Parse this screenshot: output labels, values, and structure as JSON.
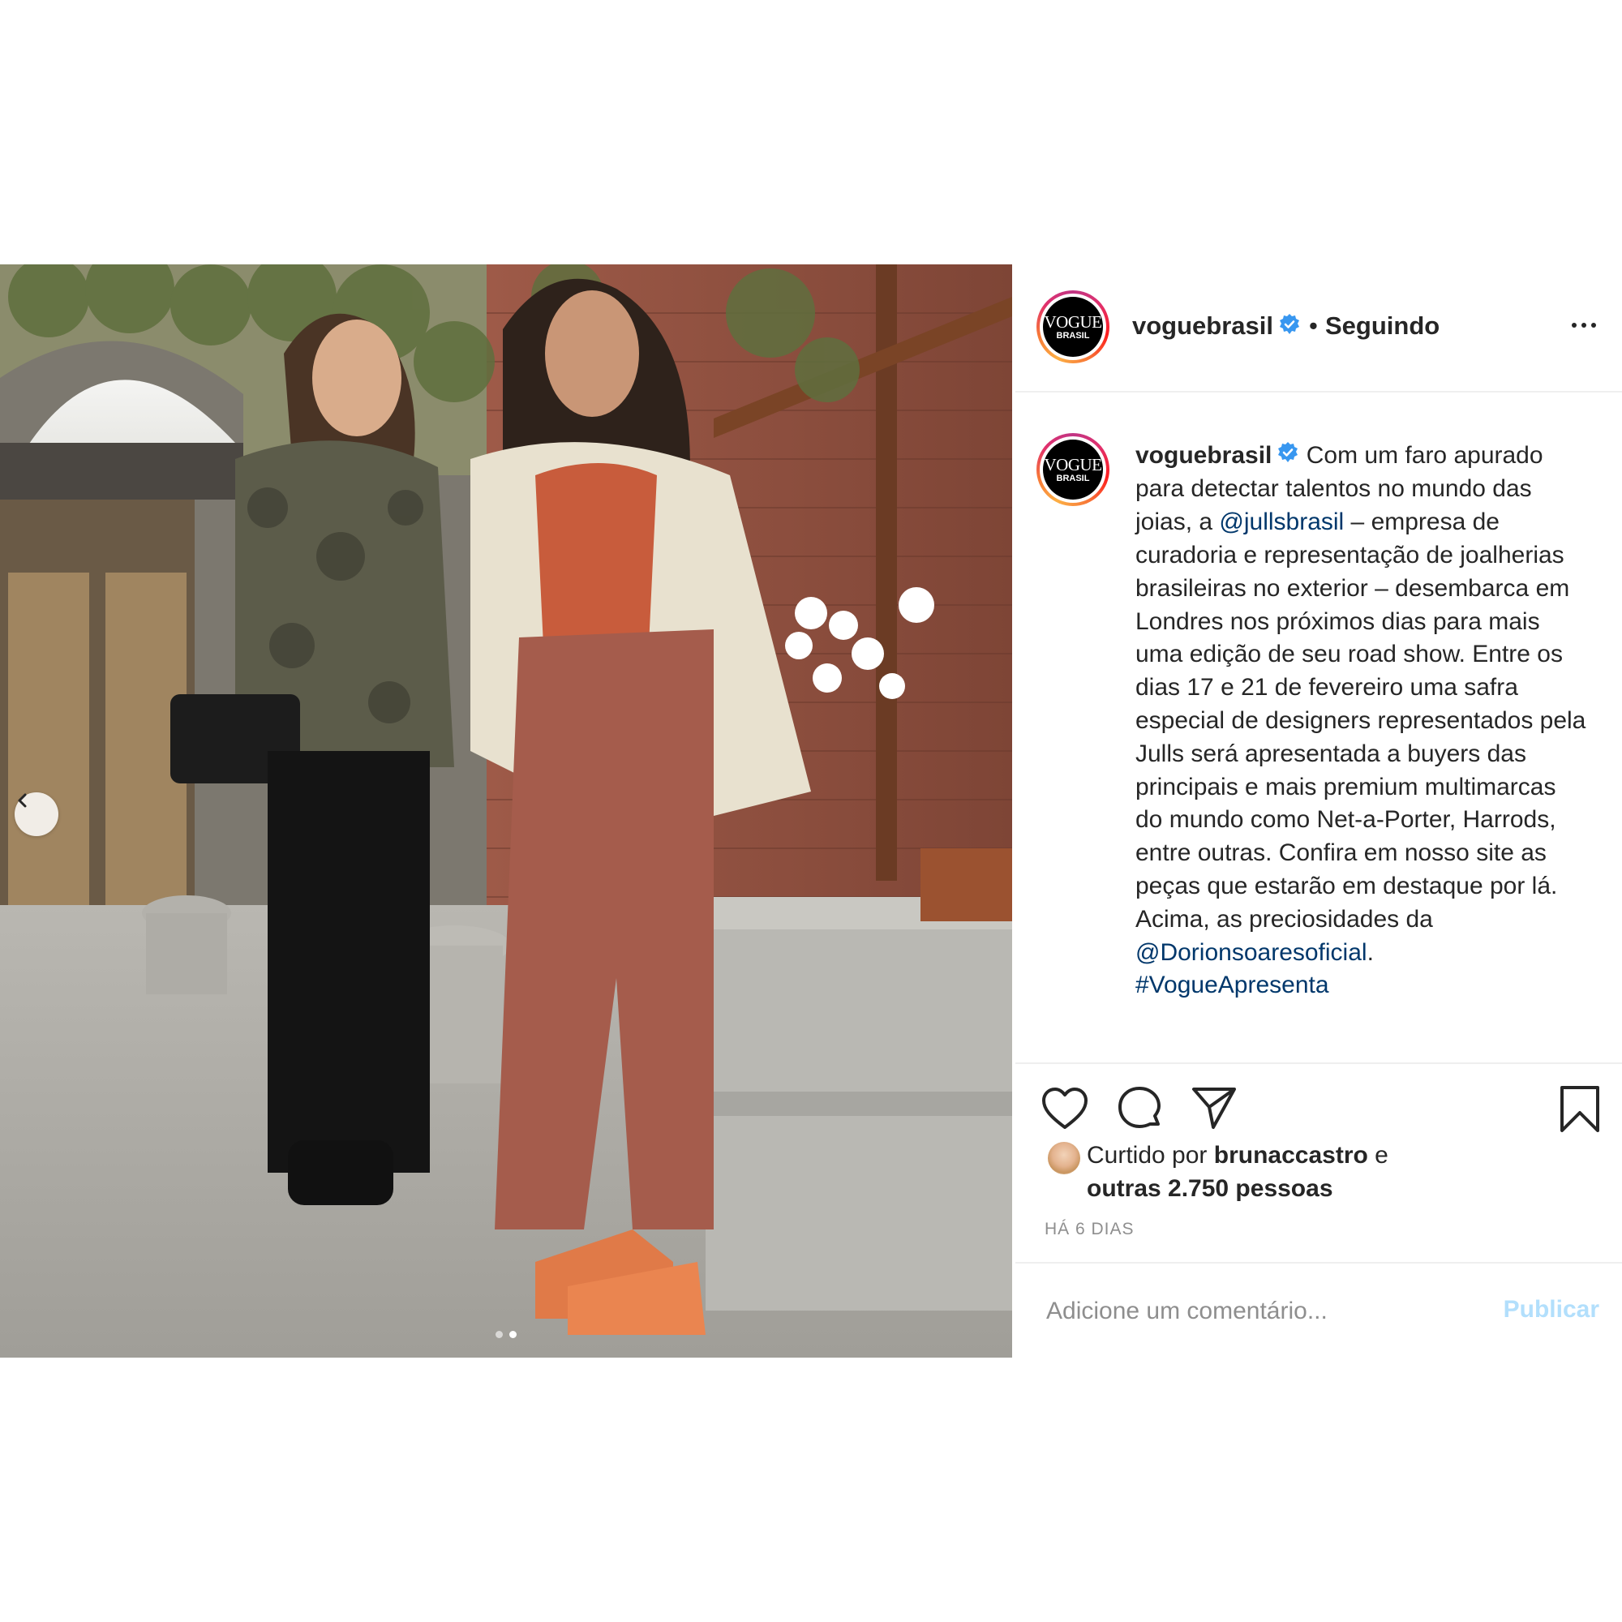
{
  "post": {
    "photo": {
      "alt_icon": "chevron-left-icon",
      "carousel_dots": 2,
      "active_dot": 1
    },
    "header": {
      "avatar_line1": "VOGUE",
      "avatar_line2": "BRASIL",
      "username": "voguebrasil",
      "separator": "•",
      "follow_status": "Seguindo",
      "more_icon": "more-options-icon"
    },
    "caption": {
      "username": "voguebrasil",
      "text_1": "Com um faro apurado para detectar talentos no mundo das joias, a ",
      "mention_1": "@jullsbrasil",
      "text_2": " – empresa de curadoria e representação de joalherias brasileiras no exterior – desembarca em Londres nos próximos dias para mais uma edição de seu road show. Entre os dias 17 e 21 de fevereiro uma safra especial de designers representados pela Julls será apresentada a buyers das principais e mais premium multimarcas do mundo como Net-a-Porter, Harrods, entre outras. Confira em nosso site as peças que estarão em destaque por lá. Acima, as preciosidades da ",
      "mention_2": "@Dorionsoaresoficial",
      "text_3": ".",
      "hashtag": "#VogueApresenta"
    },
    "likes": {
      "prefix": "Curtido por ",
      "liker": "brunaccastro",
      "middle": " e",
      "others": "outras 2.750 pessoas"
    },
    "timestamp": "HÁ 6 DIAS",
    "comment": {
      "placeholder": "Adicione um comentário...",
      "publish_label": "Publicar"
    },
    "colors": {
      "text": "#262626",
      "link": "#00376b",
      "muted": "#8e8e8e",
      "publish_disabled": "#b2dffc",
      "verified": "#3897f0",
      "divider": "#efefef"
    }
  }
}
